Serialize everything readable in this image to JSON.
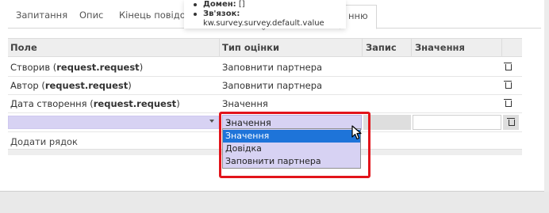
{
  "tabs": [
    {
      "label": "Запитання",
      "active": false
    },
    {
      "label": "Опис",
      "active": false
    },
    {
      "label": "Кінець повідом",
      "active": false
    },
    {
      "label": "нню",
      "active": true
    }
  ],
  "tooltip": {
    "domain_label": "Домен:",
    "domain_value": "[]",
    "link_label": "Зв'язок:",
    "link_value": "kw.survey.survey.default.value"
  },
  "grid": {
    "headers": {
      "field": "Поле",
      "eval_type": "Тип оцінки",
      "record": "Запис",
      "value": "Значення"
    },
    "rows": [
      {
        "field_prefix": "Створив (",
        "field_tech": "request.request",
        "field_suffix": ")",
        "eval_type": "Заповнити партнера"
      },
      {
        "field_prefix": "Автор (",
        "field_tech": "request.request",
        "field_suffix": ")",
        "eval_type": "Заповнити партнера"
      },
      {
        "field_prefix": "Дата створення (",
        "field_tech": "request.request",
        "field_suffix": ")",
        "eval_type": "Значення"
      }
    ],
    "edit_row": {
      "field_value": "",
      "eval_type_selected": "Значення"
    },
    "add_row_label": "Додати рядок"
  },
  "dropdown": {
    "options": [
      "Значення",
      "Довідка",
      "Заповнити партнера"
    ],
    "selected_index": 0
  },
  "colors": {
    "selection_blue": "#1e74d9",
    "edit_lavender": "#d7d2f3",
    "highlight_red": "#e2141b"
  }
}
